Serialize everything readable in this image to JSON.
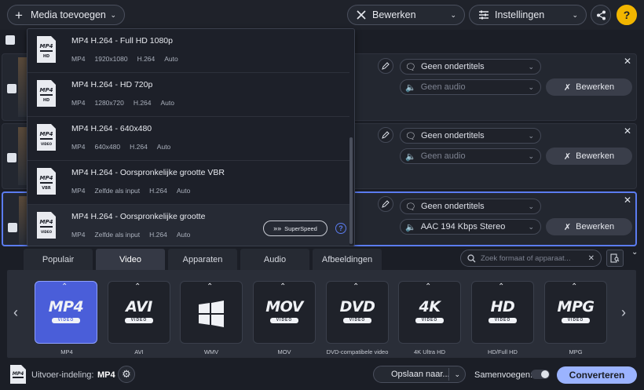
{
  "toolbar": {
    "add_media": "Media toevoegen",
    "edit": "Bewerken",
    "settings": "Instellingen",
    "help": "?"
  },
  "rows": [
    {
      "subtitles": "Geen ondertitels",
      "audio": "Geen audio",
      "edit": "Bewerken"
    },
    {
      "subtitles": "Geen ondertitels",
      "audio": "Geen audio",
      "edit": "Bewerken"
    },
    {
      "subtitles": "Geen ondertitels",
      "audio": "AAC 194 Kbps Stereo",
      "edit": "Bewerken"
    }
  ],
  "dropdown": {
    "items": [
      {
        "title": "MP4 H.264 - Full HD 1080p",
        "meta": [
          "MP4",
          "1920x1080",
          "H.264",
          "Auto"
        ],
        "badge": "HD"
      },
      {
        "title": "MP4 H.264 - HD 720p",
        "meta": [
          "MP4",
          "1280x720",
          "H.264",
          "Auto"
        ],
        "badge": "HD"
      },
      {
        "title": "MP4 H.264 - 640x480",
        "meta": [
          "MP4",
          "640x480",
          "H.264",
          "Auto"
        ],
        "badge": "VIDEO"
      },
      {
        "title": "MP4 H.264 - Oorspronkelijke grootte VBR",
        "meta": [
          "MP4",
          "Zelfde als input",
          "H.264",
          "Auto"
        ],
        "badge": "VBR"
      },
      {
        "title": "MP4 H.264 - Oorspronkelijke grootte",
        "meta": [
          "MP4",
          "Zelfde als input",
          "H.264",
          "Auto"
        ],
        "badge": "VIDEO"
      }
    ],
    "superspeed": "SuperSpeed"
  },
  "tabs": [
    "Populair",
    "Video",
    "Apparaten",
    "Audio",
    "Afbeeldingen"
  ],
  "active_tab": "Video",
  "search_placeholder": "Zoek formaat of apparaat...",
  "formats": [
    {
      "logo": "MP4",
      "bar": "VIDEO",
      "label": "MP4"
    },
    {
      "logo": "AVI",
      "bar": "VIDEO",
      "label": "AVI"
    },
    {
      "logo": "",
      "bar": "",
      "label": "WMV"
    },
    {
      "logo": "MOV",
      "bar": "VIDEO",
      "label": "MOV"
    },
    {
      "logo": "DVD",
      "bar": "VIDEO",
      "label": "DVD-compatibele video"
    },
    {
      "logo": "4K",
      "bar": "VIDEO",
      "label": "4K Ultra HD"
    },
    {
      "logo": "HD",
      "bar": "VIDEO",
      "label": "HD/Full HD"
    },
    {
      "logo": "MPG",
      "bar": "VIDEO",
      "label": "MPG"
    }
  ],
  "bottom": {
    "output_label": "Uitvoer-indeling:",
    "output_value": "MP4",
    "save_to": "Opslaan naar...",
    "merge": "Samenvoegen:",
    "convert": "Converteren"
  },
  "colors": {
    "accent": "#5b7cf0",
    "convert": "#9bb3ff",
    "help": "#f2b600"
  }
}
